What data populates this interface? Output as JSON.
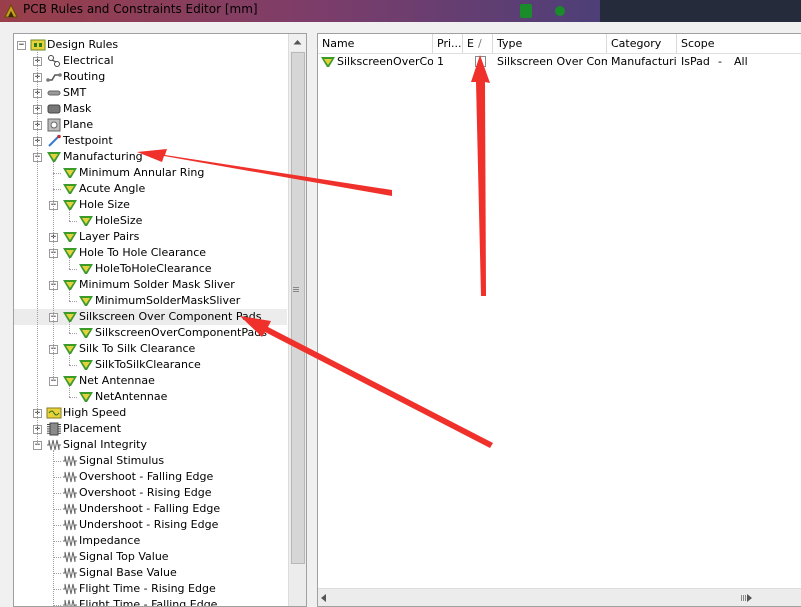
{
  "window": {
    "title": "PCB Rules and Constraints Editor [mm]"
  },
  "tree": {
    "rows": [
      {
        "label": "Design Rules",
        "level": 0,
        "expander": "−",
        "icon": "design-rules-icon",
        "name": "tree-item-design-rules"
      },
      {
        "label": "Electrical",
        "level": 1,
        "expander": "+",
        "icon": "electrical-icon",
        "name": "tree-item-electrical"
      },
      {
        "label": "Routing",
        "level": 1,
        "expander": "+",
        "icon": "routing-icon",
        "name": "tree-item-routing"
      },
      {
        "label": "SMT",
        "level": 1,
        "expander": "+",
        "icon": "smt-icon",
        "name": "tree-item-smt"
      },
      {
        "label": "Mask",
        "level": 1,
        "expander": "+",
        "icon": "mask-icon",
        "name": "tree-item-mask"
      },
      {
        "label": "Plane",
        "level": 1,
        "expander": "+",
        "icon": "plane-icon",
        "name": "tree-item-plane"
      },
      {
        "label": "Testpoint",
        "level": 1,
        "expander": "+",
        "icon": "testpoint-icon",
        "name": "tree-item-testpoint"
      },
      {
        "label": "Manufacturing",
        "level": 1,
        "expander": "−",
        "icon": "manufacturing-icon",
        "name": "tree-item-manufacturing"
      },
      {
        "label": "Minimum Annular Ring",
        "level": 2,
        "expander": "",
        "icon": "rule-icon",
        "name": "tree-item-minimum-annular-ring"
      },
      {
        "label": "Acute Angle",
        "level": 2,
        "expander": "",
        "icon": "rule-icon",
        "name": "tree-item-acute-angle"
      },
      {
        "label": "Hole Size",
        "level": 2,
        "expander": "−",
        "icon": "rule-icon",
        "name": "tree-item-hole-size"
      },
      {
        "label": "HoleSize",
        "level": 3,
        "expander": "",
        "icon": "rule-icon",
        "name": "tree-item-holesize-rule"
      },
      {
        "label": "Layer Pairs",
        "level": 2,
        "expander": "+",
        "icon": "rule-icon",
        "name": "tree-item-layer-pairs"
      },
      {
        "label": "Hole To Hole Clearance",
        "level": 2,
        "expander": "−",
        "icon": "rule-icon",
        "name": "tree-item-hole-to-hole-clearance"
      },
      {
        "label": "HoleToHoleClearance",
        "level": 3,
        "expander": "",
        "icon": "rule-icon",
        "name": "tree-item-holetoholeclearance-rule"
      },
      {
        "label": "Minimum Solder Mask Sliver",
        "level": 2,
        "expander": "−",
        "icon": "rule-icon",
        "name": "tree-item-minimum-solder-mask-sliver"
      },
      {
        "label": "MinimumSolderMaskSliver",
        "level": 3,
        "expander": "",
        "icon": "rule-icon",
        "name": "tree-item-minimumsoldermasksliver-rule"
      },
      {
        "label": "Silkscreen Over Component Pads",
        "level": 2,
        "expander": "−",
        "icon": "rule-icon",
        "name": "tree-item-silkscreen-over-component-pads",
        "selected": true
      },
      {
        "label": "SilkscreenOverComponentPads",
        "level": 3,
        "expander": "",
        "icon": "rule-icon",
        "name": "tree-item-silkscreenovercomponentpads-rule"
      },
      {
        "label": "Silk To Silk Clearance",
        "level": 2,
        "expander": "−",
        "icon": "rule-icon",
        "name": "tree-item-silk-to-silk-clearance"
      },
      {
        "label": "SilkToSilkClearance",
        "level": 3,
        "expander": "",
        "icon": "rule-icon",
        "name": "tree-item-silktosilkclearance-rule"
      },
      {
        "label": "Net Antennae",
        "level": 2,
        "expander": "−",
        "icon": "rule-icon",
        "name": "tree-item-net-antennae"
      },
      {
        "label": "NetAntennae",
        "level": 3,
        "expander": "",
        "icon": "rule-icon",
        "name": "tree-item-netantennae-rule"
      },
      {
        "label": "High Speed",
        "level": 1,
        "expander": "+",
        "icon": "high-speed-icon",
        "name": "tree-item-high-speed"
      },
      {
        "label": "Placement",
        "level": 1,
        "expander": "+",
        "icon": "placement-icon",
        "name": "tree-item-placement"
      },
      {
        "label": "Signal Integrity",
        "level": 1,
        "expander": "−",
        "icon": "signal-integrity-icon",
        "name": "tree-item-signal-integrity"
      },
      {
        "label": "Signal Stimulus",
        "level": 2,
        "expander": "",
        "icon": "signal-icon",
        "name": "tree-item-signal-stimulus"
      },
      {
        "label": "Overshoot - Falling Edge",
        "level": 2,
        "expander": "",
        "icon": "signal-icon",
        "name": "tree-item-overshoot-falling-edge"
      },
      {
        "label": "Overshoot - Rising Edge",
        "level": 2,
        "expander": "",
        "icon": "signal-icon",
        "name": "tree-item-overshoot-rising-edge"
      },
      {
        "label": "Undershoot - Falling Edge",
        "level": 2,
        "expander": "",
        "icon": "signal-icon",
        "name": "tree-item-undershoot-falling-edge"
      },
      {
        "label": "Undershoot - Rising Edge",
        "level": 2,
        "expander": "",
        "icon": "signal-icon",
        "name": "tree-item-undershoot-rising-edge"
      },
      {
        "label": "Impedance",
        "level": 2,
        "expander": "",
        "icon": "signal-icon",
        "name": "tree-item-impedance"
      },
      {
        "label": "Signal Top Value",
        "level": 2,
        "expander": "",
        "icon": "signal-icon",
        "name": "tree-item-signal-top-value"
      },
      {
        "label": "Signal Base Value",
        "level": 2,
        "expander": "",
        "icon": "signal-icon",
        "name": "tree-item-signal-base-value"
      },
      {
        "label": "Flight Time - Rising Edge",
        "level": 2,
        "expander": "",
        "icon": "signal-icon",
        "name": "tree-item-flight-time-rising-edge"
      },
      {
        "label": "Flight Time - Falling Edge",
        "level": 2,
        "expander": "",
        "icon": "signal-icon",
        "name": "tree-item-flight-time-falling-edge"
      }
    ]
  },
  "grid": {
    "columns": [
      {
        "label": "Name",
        "name": "column-name"
      },
      {
        "label": "Pri...",
        "name": "column-priority"
      },
      {
        "label": "E",
        "name": "column-enabled"
      },
      {
        "label": "/",
        "name": "column-sort-indicator"
      },
      {
        "label": "Type",
        "name": "column-type"
      },
      {
        "label": "Category",
        "name": "column-category"
      },
      {
        "label": "Scope",
        "name": "column-scope"
      }
    ],
    "row": {
      "name": "SilkscreenOverComponentPads",
      "priority": "1",
      "enabled": false,
      "type": "Silkscreen Over Component Pads",
      "category": "Manufacturing",
      "scope_kind": "IsPad",
      "scope_sep": "-",
      "scope_value": "All"
    }
  },
  "colors": {
    "annotation_arrow": "#f0302a",
    "rule_icon_green": "#3a9a2a",
    "rule_icon_yellow": "#e8d23a"
  }
}
